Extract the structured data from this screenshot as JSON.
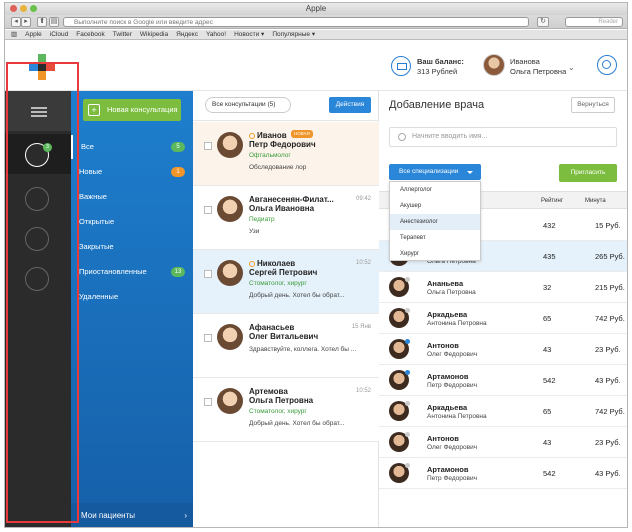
{
  "window": {
    "title": "Apple",
    "url_placeholder": "Выполните поиск в Google или введите адрес",
    "reader": "Reader"
  },
  "bookmarks": [
    "Apple",
    "iCloud",
    "Facebook",
    "Twitter",
    "Wikipedia",
    "Яндекс",
    "Yahoo!",
    "Новости ▾",
    "Популярные ▾"
  ],
  "header": {
    "balance_label": "Ваш баланс:",
    "balance_value": "313 Рублей",
    "user_first": "Иванова",
    "user_last": "Ольга Петровна"
  },
  "nav": {
    "new_consult": "Новая консультация",
    "badge": "3",
    "filters": [
      {
        "label": "Все",
        "count": "5",
        "color": "#5cb85c"
      },
      {
        "label": "Новые",
        "count": "1",
        "color": "#f0952a"
      },
      {
        "label": "Важные",
        "count": "",
        "color": ""
      },
      {
        "label": "Открытые",
        "count": "",
        "color": ""
      },
      {
        "label": "Закрытые",
        "count": "",
        "color": ""
      },
      {
        "label": "Приостановленные",
        "count": "13",
        "color": "#5cb85c"
      },
      {
        "label": "Удаленные",
        "count": "",
        "color": ""
      }
    ],
    "my_patients": "Мои пациенты"
  },
  "conv": {
    "select_all": "Все консультации (5)",
    "actions": "Действия",
    "items": [
      {
        "name1": "Иванов",
        "name2": "Петр Федорович",
        "tag": "Офтальмолог",
        "msg": "Обследование лор",
        "time": "",
        "badge": "НОВАЯ"
      },
      {
        "name1": "Авганесенян-Филат...",
        "name2": "Ольга Ивановна",
        "tag": "Педиатр",
        "msg": "Узи",
        "time": "09:42",
        "badge": ""
      },
      {
        "name1": "Николаев",
        "name2": "Сергей Петрович",
        "tag": "Стоматолог, хирург",
        "msg": "Добрый день. Хотел бы обрат...",
        "time": "10:52",
        "badge": ""
      },
      {
        "name1": "Афанасьев",
        "name2": "Олег Витальевич",
        "tag": "",
        "msg": "Здравствуйте, коллега. Хотел бы ...",
        "time": "15 Янв",
        "badge": ""
      },
      {
        "name1": "Артемова",
        "name2": "Ольга Петровна",
        "tag": "Стоматолог, хирург",
        "msg": "Добрый день. Хотел бы обрат...",
        "time": "10:52",
        "badge": ""
      }
    ]
  },
  "panel": {
    "title": "Добавление врача",
    "return": "Вернуться",
    "search_placeholder": "Начните вводить имя...",
    "spec": "Все специализации",
    "invite": "Пригласить",
    "dropdown": [
      "Аллерголог",
      "Акушер",
      "Анестезиолог",
      "Терапевт",
      "Хирург"
    ],
    "col_rating": "Рейтинг",
    "col_minute": "Минута",
    "doctors": [
      {
        "n1": "",
        "n2": "",
        "r": "432",
        "p": "15 Руб."
      },
      {
        "n1": "",
        "n2": "Ольга Петровна",
        "r": "435",
        "p": "265 Руб."
      },
      {
        "n1": "Ананьева",
        "n2": "Ольга Петровна",
        "r": "32",
        "p": "215 Руб."
      },
      {
        "n1": "Аркадьева",
        "n2": "Антонина Петровна",
        "r": "65",
        "p": "742 Руб."
      },
      {
        "n1": "Антонов",
        "n2": "Олег Федорович",
        "r": "43",
        "p": "23 Руб."
      },
      {
        "n1": "Артамонов",
        "n2": "Петр Федорович",
        "r": "542",
        "p": "43 Руб."
      },
      {
        "n1": "Аркадьева",
        "n2": "Антонина Петровна",
        "r": "65",
        "p": "742 Руб."
      },
      {
        "n1": "Антонов",
        "n2": "Олег Федорович",
        "r": "43",
        "p": "23 Руб."
      },
      {
        "n1": "Артамонов",
        "n2": "Петр Федорович",
        "r": "542",
        "p": "43 Руб."
      }
    ]
  }
}
